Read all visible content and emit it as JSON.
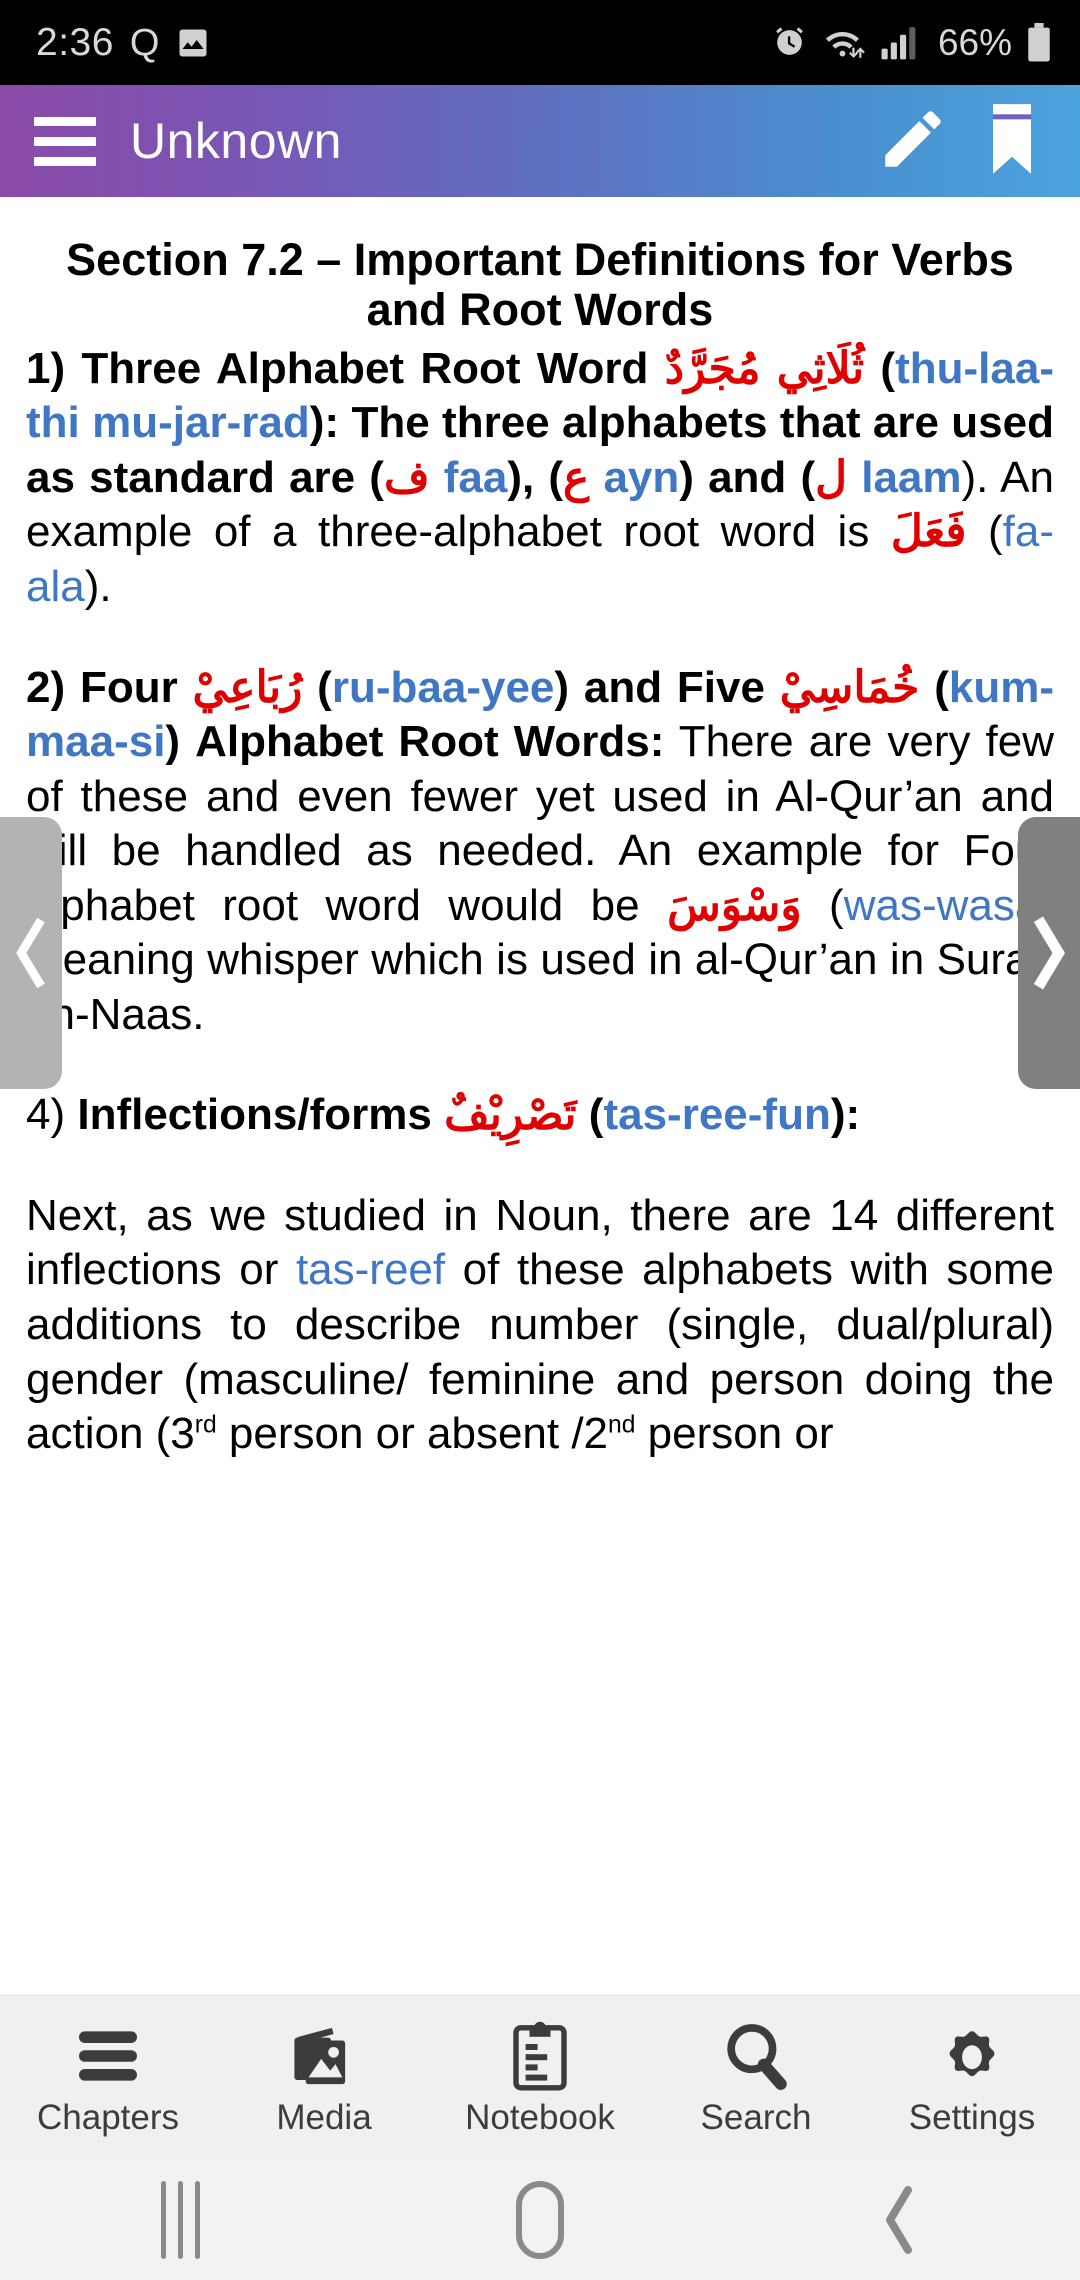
{
  "status_bar": {
    "time": "2:36",
    "quiet_icon": "Q",
    "image_icon": "image-icon",
    "alarm_icon": "alarm-icon",
    "wifi_icon": "wifi-icon",
    "signal_icon": "signal-bars-icon",
    "battery_percent": "66%",
    "battery_icon": "battery-icon"
  },
  "app_bar": {
    "menu_icon": "hamburger-menu-icon",
    "title": "Unknown",
    "edit_icon": "pencil-edit-icon",
    "bookmark_icon": "bookmark-icon"
  },
  "page_nav": {
    "prev_label": "‹",
    "next_label": "›",
    "prev_color": "#b3b3b3",
    "next_color": "#808080"
  },
  "document": {
    "title": "Section 7.2 – Important Definitions for Verbs and Root Words",
    "para1": {
      "num": "1) ",
      "lead": "Three Alphabet Root Word ",
      "arabic1": "ثُلَاثِي مُجَرَّدٌ",
      "translit1": "thu-laa-thi mu-jar-rad",
      "mid1": "): The three alphabets that are used as standard are (",
      "arabic2": "ف",
      "translit2": "faa",
      "mid2": "), (",
      "arabic3": "ع",
      "translit3": "ayn",
      "mid3": ") and (",
      "arabic4": "ل",
      "translit4": "laam",
      "tail_normal": "). An example of a three-alphabet root word is ",
      "arabic5": "فَعَلَ",
      "translit5": "fa-ala",
      "end": ")."
    },
    "para2": {
      "num": "2) ",
      "lead": "Four ",
      "arabic1": "رُبَاعِيْ",
      "translit1": "ru-baa-yee",
      "mid1": ") and Five ",
      "arabic2": "خُمَاسِيْ",
      "translit2": "kum-maa-si",
      "mid2": ") Alphabet Root Words:",
      "body_normal": " There are very few of these and even fewer yet used in Al-Qur’an and will be handled as needed. An example for Four alphabet root word would be ",
      "arabic3": "وَسْوَسَ",
      "translit3": "was-wasa",
      "end": ") meaning whisper which is used in al-Qur’an in Surah an-Naas."
    },
    "para3": {
      "num": "4) ",
      "lead": "Inflections/forms ",
      "arabic1": "تَصْرِيْفٌ",
      "translit1": "tas-ree-fun",
      "end": "):"
    },
    "para4": {
      "seg1": "Next, as we studied in Noun, there are 14 different inflections or ",
      "link": "tas-reef",
      "seg2": " of these alphabets with some additions to describe number (single, dual/plural) gender (masculine/ feminine and person doing the action (3",
      "sup1": "rd",
      "seg3": " person or absent /2",
      "sup2": "nd",
      "seg4": " person or"
    }
  },
  "tab_bar": {
    "items": [
      {
        "label": "Chapters",
        "icon": "list-lines-icon"
      },
      {
        "label": "Media",
        "icon": "photos-icon"
      },
      {
        "label": "Notebook",
        "icon": "clipboard-icon"
      },
      {
        "label": "Search",
        "icon": "search-magnifier-icon"
      },
      {
        "label": "Settings",
        "icon": "gear-icon"
      }
    ]
  },
  "system_nav": {
    "recents_icon": "recents-icon",
    "home_icon": "home-icon",
    "back_icon": "back-chevron-icon"
  },
  "colors": {
    "arabic_red": "#e00000",
    "translit_blue": "#3f77c4",
    "appbar_gradient_start": "#8b4aa8",
    "appbar_gradient_end": "#4ba3dd",
    "tabbar_bg": "#f0f0f0"
  }
}
